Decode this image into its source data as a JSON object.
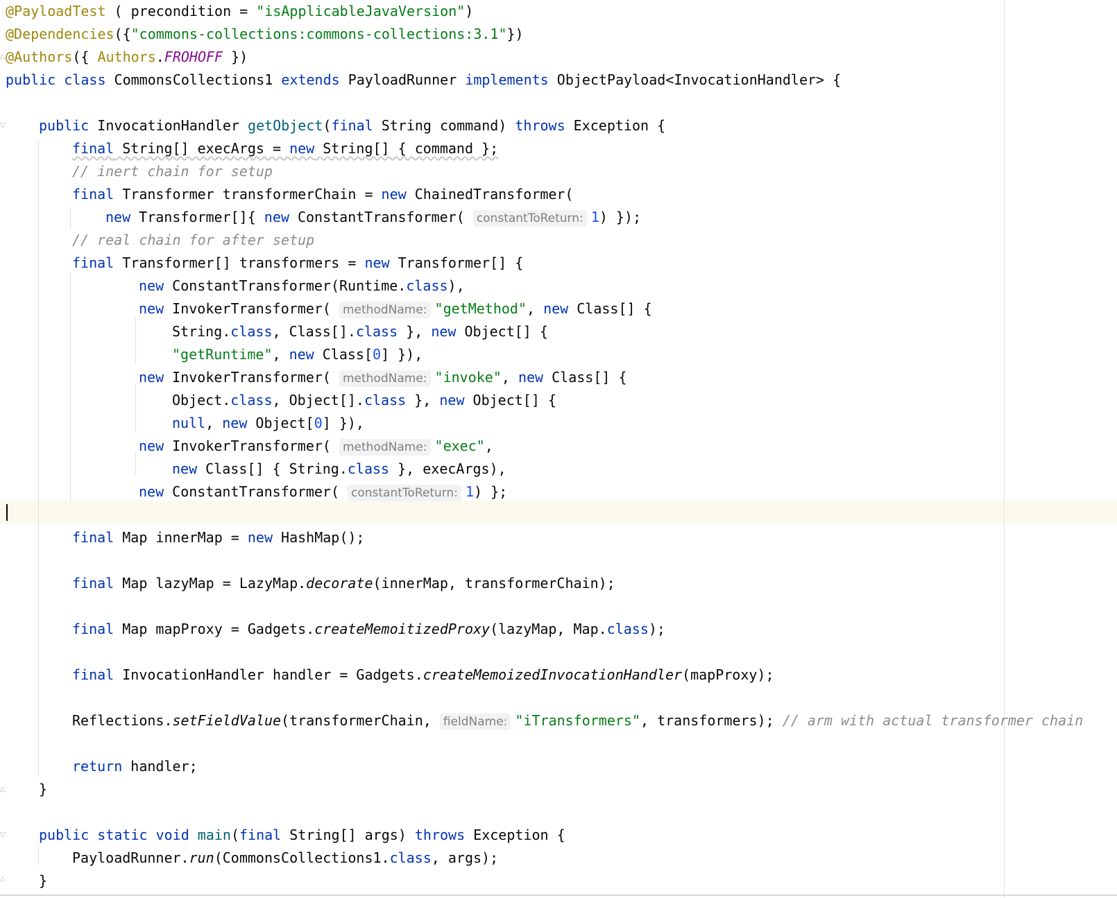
{
  "code": {
    "annotation_payloadtest": "@PayloadTest",
    "precondition_param": "precondition",
    "precondition_value": "\"isApplicableJavaVersion\"",
    "annotation_dependencies": "@Dependencies",
    "dependency_value": "\"commons-collections:commons-collections:3.1\"",
    "annotation_authors": "@Authors",
    "authors_class": "Authors",
    "authors_field": "FROHOFF",
    "class_name": "CommonsCollections1",
    "parent_class": "PayloadRunner",
    "interface_name": "ObjectPayload<InvocationHandler>",
    "method_getobject": "getObject",
    "comment_inert": "// inert chain for setup",
    "comment_real": "// real chain for after setup",
    "hint_constant_to_return": "constantToReturn:",
    "hint_method_name": "methodName:",
    "hint_field_name": "fieldName:",
    "str_getmethod": "\"getMethod\"",
    "str_getruntime": "\"getRuntime\"",
    "str_invoke": "\"invoke\"",
    "str_exec": "\"exec\"",
    "str_itransformers": "\"iTransformers\"",
    "num_one": "1",
    "num_zero": "0",
    "method_decorate": "decorate",
    "method_create_proxy": "createMemoitizedProxy",
    "method_create_handler": "createMemoizedInvocationHandler",
    "method_set_field": "setFieldValue",
    "comment_arm": "// arm with actual transformer chain",
    "method_main": "main",
    "method_run": "run"
  }
}
